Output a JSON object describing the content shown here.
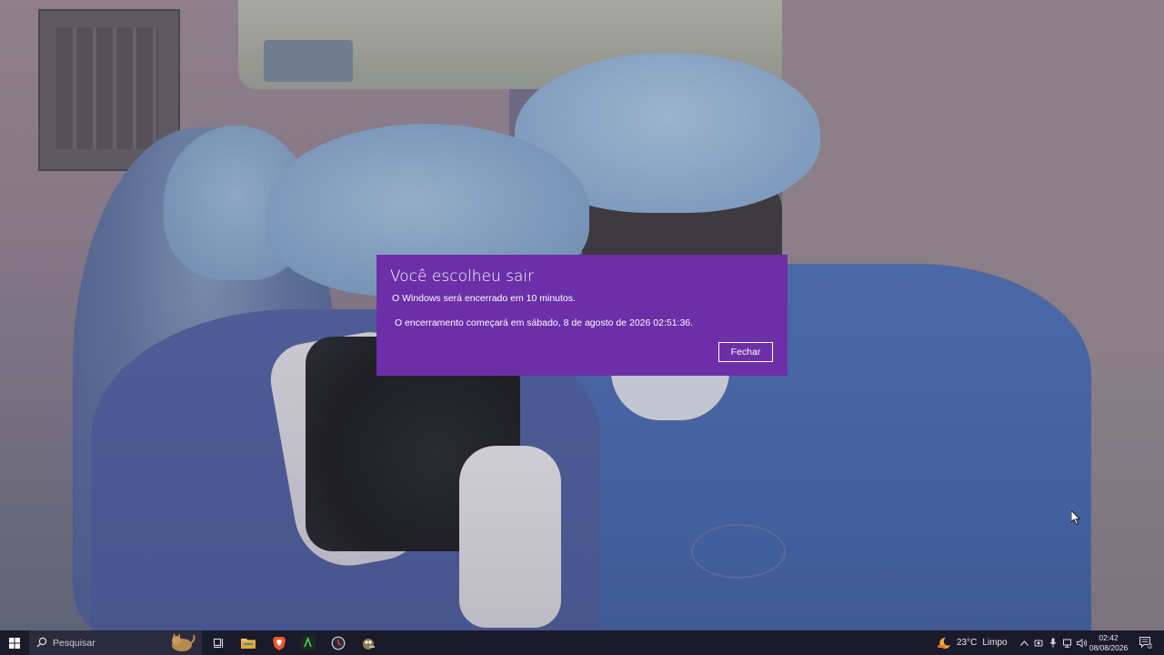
{
  "dialog": {
    "title": "Você escolheu sair",
    "message": "O Windows será encerrado em 10 minutos.",
    "detail": "O encerramento começará em sábado, 8 de agosto de 2026 02:51:36.",
    "close_label": "Fechar",
    "background_color": "#6c2fa8"
  },
  "taskbar": {
    "background_color": "#1b1a2b",
    "start_icon": "windows-logo-icon",
    "search": {
      "placeholder": "Pesquisar",
      "icon": "search-icon"
    },
    "pinned_apps": [
      {
        "name": "file-explorer",
        "icon": "folder-icon"
      },
      {
        "name": "brave-browser",
        "icon": "brave-lion-icon"
      },
      {
        "name": "terminal",
        "icon": "terminal-icon"
      },
      {
        "name": "clock-app",
        "icon": "clock-icon"
      },
      {
        "name": "gimp",
        "icon": "gimp-icon"
      }
    ],
    "weather": {
      "temperature": "23°C",
      "condition": "Limpo"
    },
    "clock": {
      "time": "02:42",
      "date": "08/08/2026"
    },
    "notification_count": "3"
  }
}
